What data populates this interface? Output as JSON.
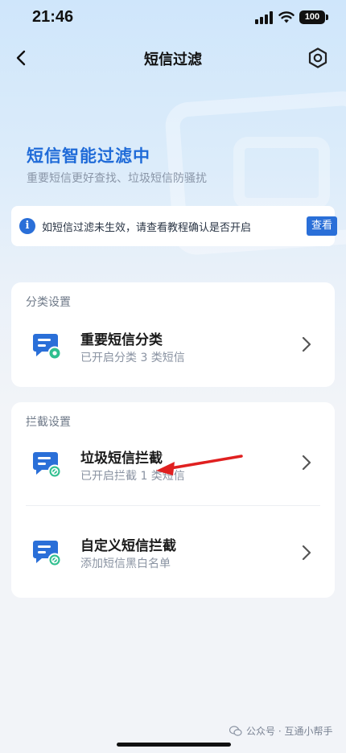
{
  "status_bar": {
    "time": "21:46",
    "battery": "100"
  },
  "nav": {
    "title": "短信过滤"
  },
  "hero": {
    "title": "短信智能过滤中",
    "subtitle": "重要短信更好查找、垃圾短信防骚扰"
  },
  "notice": {
    "text": "如短信过滤未生效，请查看教程确认是否开启",
    "button": "查看"
  },
  "classify": {
    "section_title": "分类设置",
    "items": [
      {
        "title": "重要短信分类",
        "subtitle": "已开启分类 3 类短信"
      }
    ]
  },
  "intercept": {
    "section_title": "拦截设置",
    "items": [
      {
        "title": "垃圾短信拦截",
        "subtitle": "已开启拦截 1 类短信"
      },
      {
        "title": "自定义短信拦截",
        "subtitle": "添加短信黑白名单"
      }
    ]
  },
  "watermark": "公众号 · 互通小帮手",
  "colors": {
    "accent": "#2a6fd8",
    "annotation_arrow": "#e02020"
  }
}
